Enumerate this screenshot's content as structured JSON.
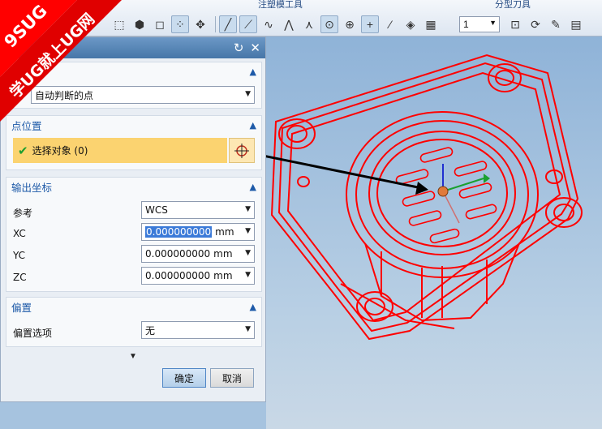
{
  "toolbar": {
    "group_labels": [
      "注塑模工具",
      "分型刀具"
    ],
    "count_value": "1"
  },
  "watermark": {
    "line1": "9SUG",
    "line2": "学UG就上UG网"
  },
  "dialog": {
    "type_value": "自动判断的点",
    "point_section": {
      "title": "点位置",
      "select_label": "选择对象 (0)"
    },
    "output_section": {
      "title": "输出坐标",
      "ref_label": "参考",
      "ref_value": "WCS",
      "xc_label": "XC",
      "yc_label": "YC",
      "zc_label": "ZC",
      "xc_value": "0.000000000",
      "yc_value": "0.000000000",
      "zc_value": "0.000000000",
      "unit": "mm"
    },
    "offset_section": {
      "title": "偏置",
      "option_label": "偏置选项",
      "option_value": "无"
    },
    "ok_label": "确定",
    "cancel_label": "取消"
  },
  "colors": {
    "model": "#ff0000",
    "accent": "#1e5aa8",
    "selection_bar": "#fbd370"
  }
}
